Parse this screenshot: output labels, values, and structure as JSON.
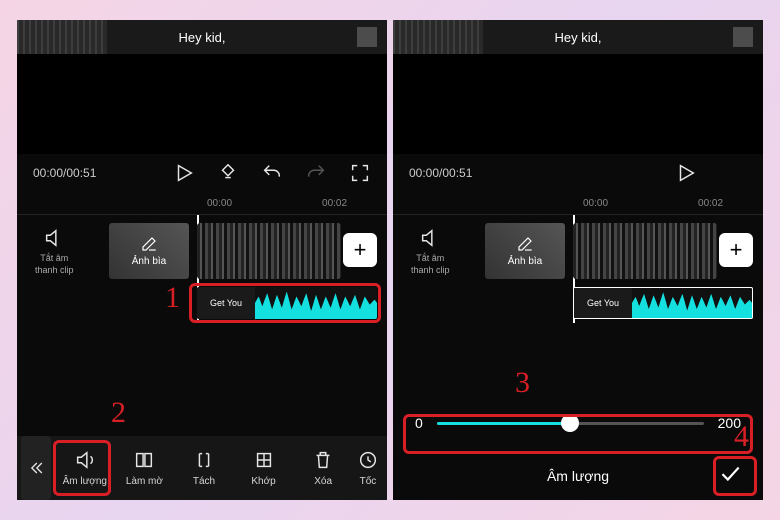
{
  "preview": {
    "title": "Hey kid,"
  },
  "timecode": "00:00/00:51",
  "ruler": {
    "t0": "00:00",
    "t1": "00:02"
  },
  "mute_clip": {
    "line1": "Tắt âm",
    "line2": "thanh clip"
  },
  "clip_thumb_label": "Ảnh bìa",
  "audio_label": "Get You",
  "toolbar": {
    "volume": "Âm lượng",
    "blur": "Làm mờ",
    "split": "Tách",
    "match": "Khớp",
    "delete": "Xóa",
    "speed": "Tốc"
  },
  "callouts": {
    "n1": "1",
    "n2": "2",
    "n3": "3",
    "n4": "4"
  },
  "slider": {
    "min": "0",
    "max": "200"
  },
  "bottom_label": "Âm lượng"
}
